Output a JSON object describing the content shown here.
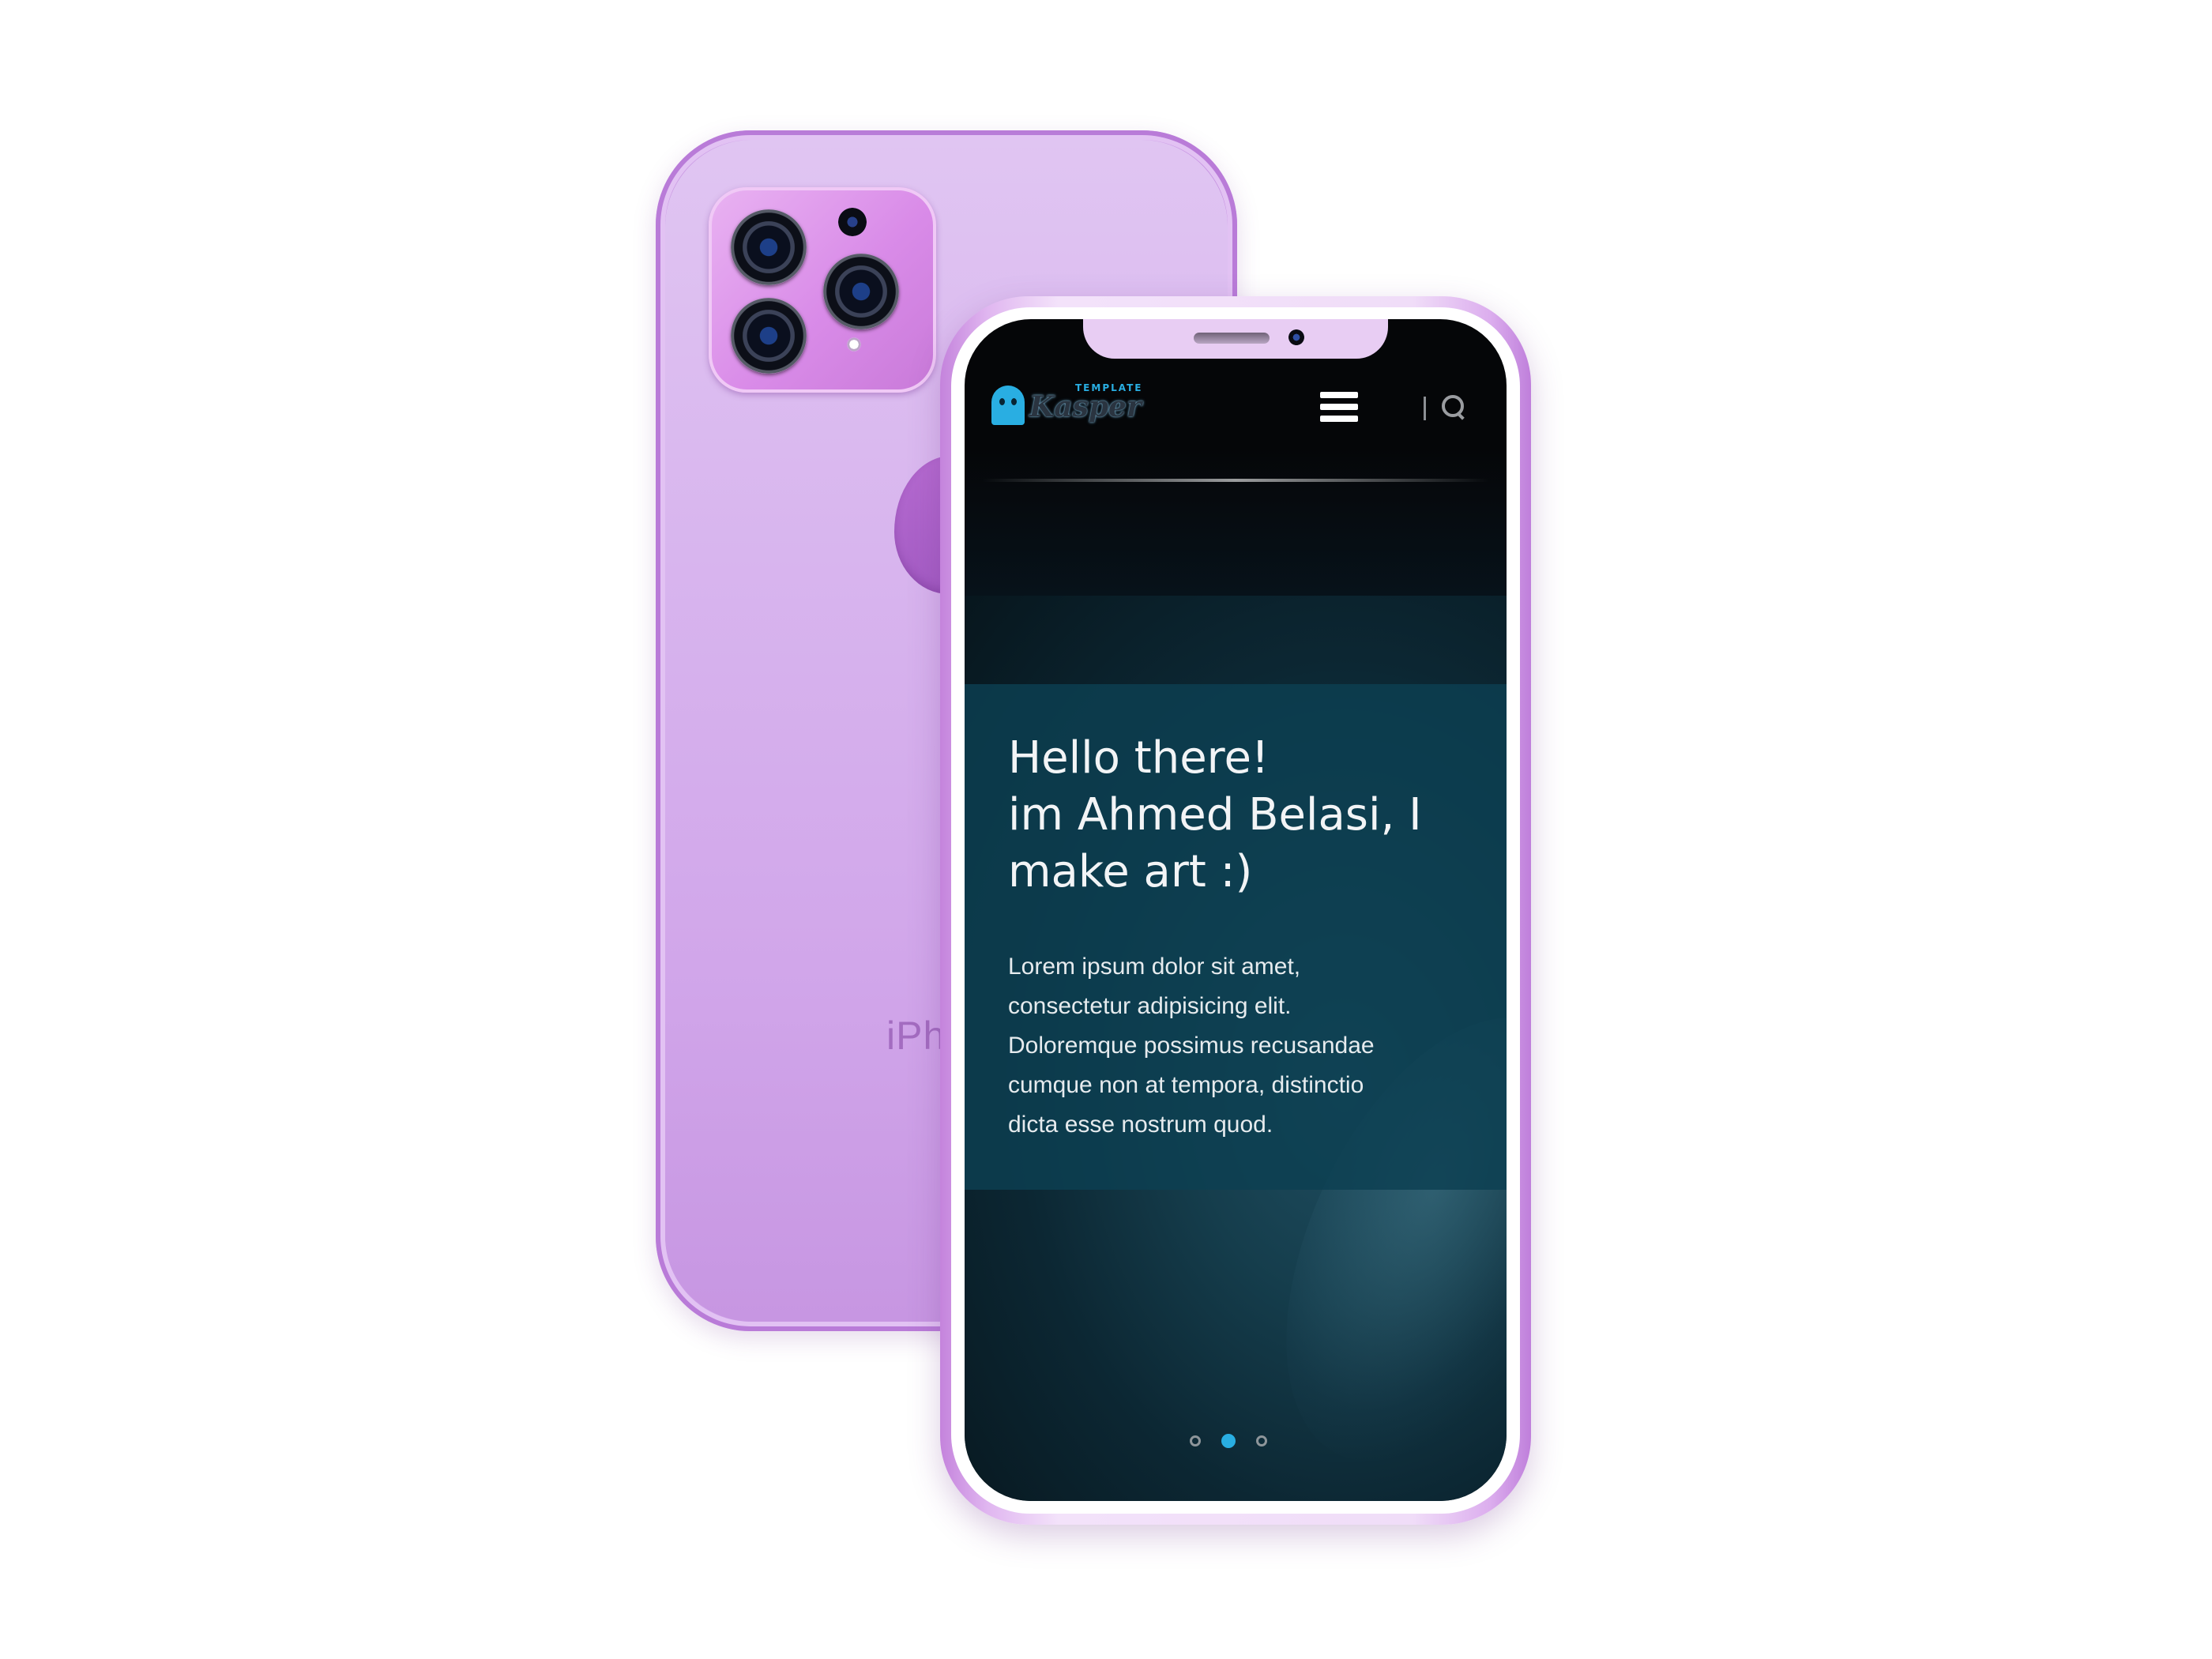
{
  "back_phone": {
    "brand_text": "iPh",
    "color": "#d6aeee"
  },
  "site": {
    "logo": {
      "name": "Kasper",
      "tagline": "TEMPLATE",
      "icon": "ghost-icon",
      "color": "#29aee2"
    },
    "nav": {
      "menu_icon": "hamburger-menu-icon",
      "search_icon": "search-icon"
    },
    "hero": {
      "title_lines": [
        "Hello there!",
        "im Ahmed Belasi, I",
        "make art :)"
      ],
      "text_lines": [
        "Lorem ipsum dolor sit amet,",
        "consectetur adipisicing elit.",
        "Doloremque possimus recusandae",
        "cumque non at tempora, distinctio",
        "dicta esse nostrum quod."
      ]
    },
    "slider": {
      "dot_count": 3,
      "active_index": 1
    }
  }
}
